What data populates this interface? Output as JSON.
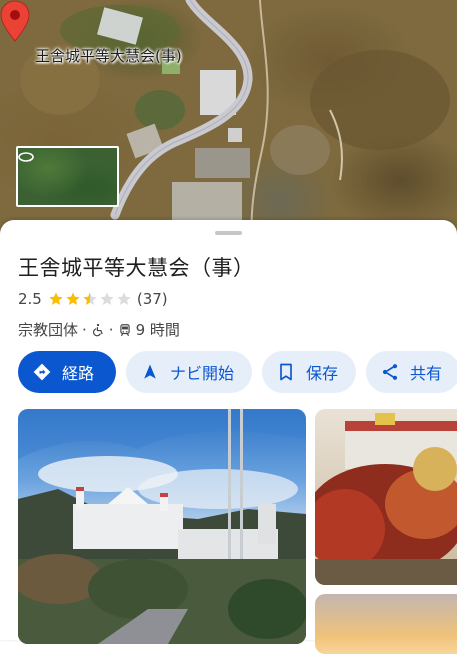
{
  "map": {
    "place_label": "王舎城平等大慧会(事)",
    "pin_icon": "map-pin-icon",
    "street_view_icon": "street-view-360-icon"
  },
  "place": {
    "name": "王舎城平等大慧会（事）",
    "rating": "2.5",
    "rating_value": 2.5,
    "rating_max": 5,
    "review_count": "(37)",
    "category": "宗教団体",
    "separator": "·",
    "accessibility_icon": "wheelchair-icon",
    "transit_icon": "train-icon",
    "travel_time": "9 時間"
  },
  "actions": {
    "directions": "経路",
    "start_navigation": "ナビ開始",
    "save": "保存",
    "share": "共有"
  },
  "colors": {
    "primary": "#0b57d0",
    "tonal_chip": "#e6eef9",
    "star": "#fbbc04",
    "pin": "#ea4335"
  }
}
